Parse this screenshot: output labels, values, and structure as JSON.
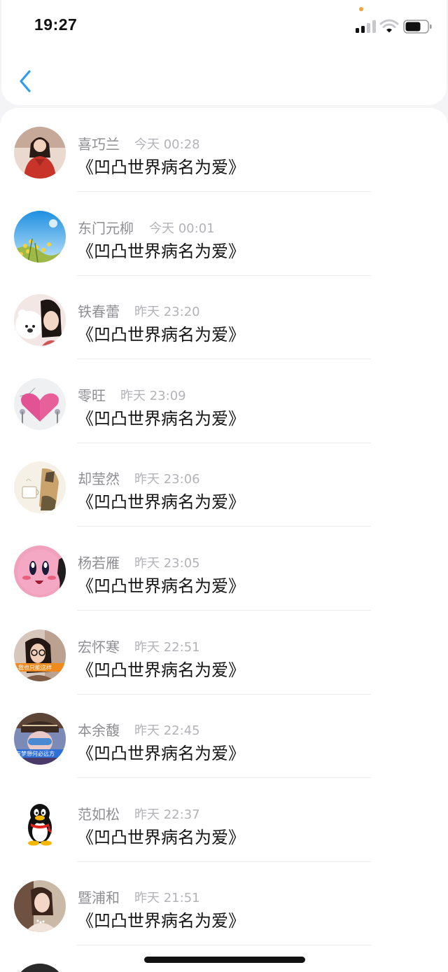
{
  "status_bar": {
    "time": "19:27",
    "privacy_dot_color": "#f2a33a",
    "battery_level": 0.7
  },
  "nav": {
    "back_icon": "chevron-left-icon",
    "accent_color": "#2f9cf0"
  },
  "list": [
    {
      "name": "喜巧兰",
      "time": "今天 00:28",
      "message": "《凹凸世界病名为爱》",
      "avatar": "portrait-red-dress"
    },
    {
      "name": "东门元柳",
      "time": "今天 00:01",
      "message": "《凹凸世界病名为爱》",
      "avatar": "blue-sky-flowers"
    },
    {
      "name": "铁春蕾",
      "time": "昨天 23:20",
      "message": "《凹凸世界病名为爱》",
      "avatar": "girl-with-bear"
    },
    {
      "name": "零旺",
      "time": "昨天 23:09",
      "message": "《凹凸世界病名为爱》",
      "avatar": "pink-heart"
    },
    {
      "name": "却莹然",
      "time": "昨天 23:06",
      "message": "《凹凸世界病名为爱》",
      "avatar": "illustration-cup"
    },
    {
      "name": "杨若雁",
      "time": "昨天 23:05",
      "message": "《凹凸世界病名为爱》",
      "avatar": "pink-kirby"
    },
    {
      "name": "宏怀寒",
      "time": "昨天 22:51",
      "message": "《凹凸世界病名为爱》",
      "avatar": "girl-glasses",
      "avatar_caption": "我也只能这样"
    },
    {
      "name": "本余馥",
      "time": "昨天 22:45",
      "message": "《凹凸世界病名为爱》",
      "avatar": "girl-cap",
      "avatar_caption": "有梦想何必远方"
    },
    {
      "name": "范如松",
      "time": "昨天 22:37",
      "message": "《凹凸世界病名为爱》",
      "avatar": "qq-penguin"
    },
    {
      "name": "暨浦和",
      "time": "昨天 21:51",
      "message": "《凹凸世界病名为爱》",
      "avatar": "portrait-woman"
    }
  ]
}
